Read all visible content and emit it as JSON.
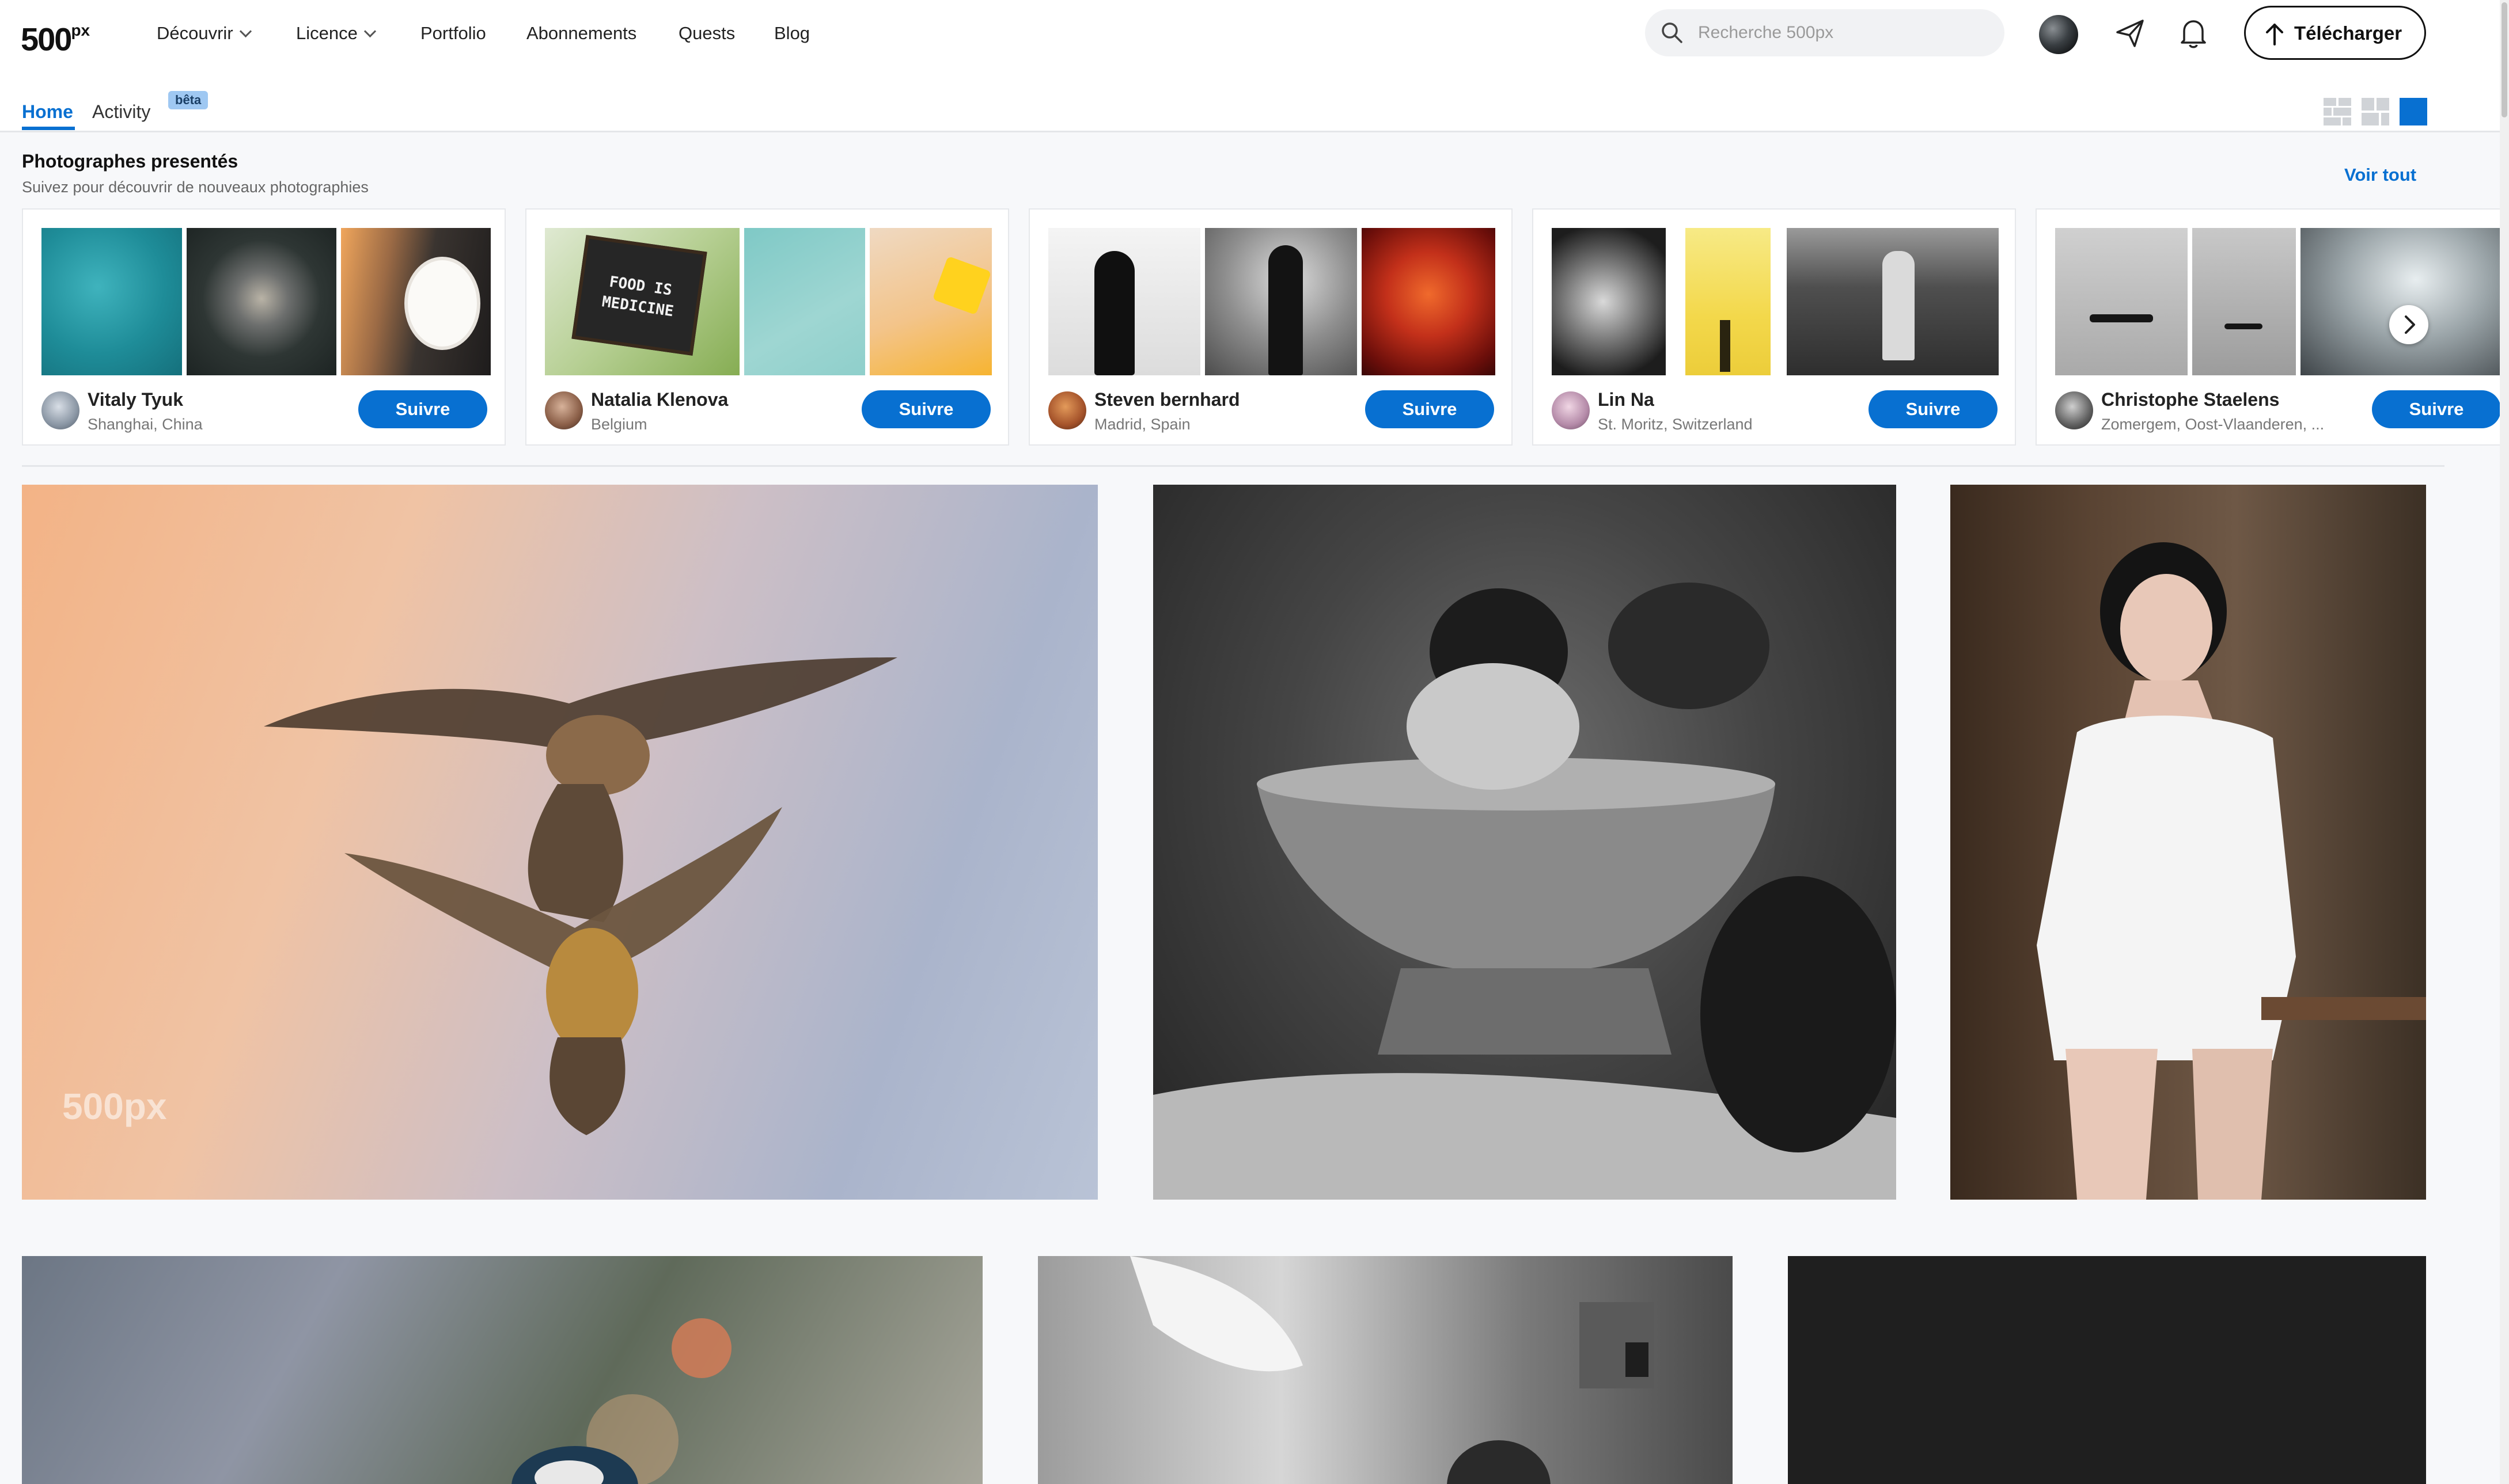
{
  "brand": {
    "logo_text": "500",
    "logo_sup": "px",
    "accent": "#0870d1"
  },
  "nav": {
    "items": [
      "Découvrir",
      "Licence",
      "Portfolio",
      "Abonnements",
      "Quests",
      "Blog"
    ],
    "search_placeholder": "Recherche 500px",
    "upload_label": "Télécharger",
    "icons": [
      "search-icon",
      "avatar",
      "send-icon",
      "bell-icon",
      "upload-icon"
    ]
  },
  "tabs": {
    "home": "Home",
    "activity": "Activity",
    "beta": "bêta"
  },
  "featured": {
    "title": "Photographes presentés",
    "subtitle": "Suivez pour découvrir de nouveaux photographies",
    "see_all": "Voir tout",
    "follow_label": "Suivre",
    "photographers": [
      {
        "name": "Vitaly Tyuk",
        "location": "Shanghai, China"
      },
      {
        "name": "Natalia Klenova",
        "location": "Belgium"
      },
      {
        "name": "Steven bernhard",
        "location": "Madrid, Spain"
      },
      {
        "name": "Lin Na",
        "location": "St. Moritz, Switzerland"
      },
      {
        "name": "Christophe Staelens",
        "location": "Zomergem, Oost-Vlaanderen, ..."
      }
    ],
    "thumb_text": {
      "food_line1": "FOOD IS",
      "food_line2": "MEDICINE"
    }
  },
  "photos": {
    "watermark": "500px"
  }
}
